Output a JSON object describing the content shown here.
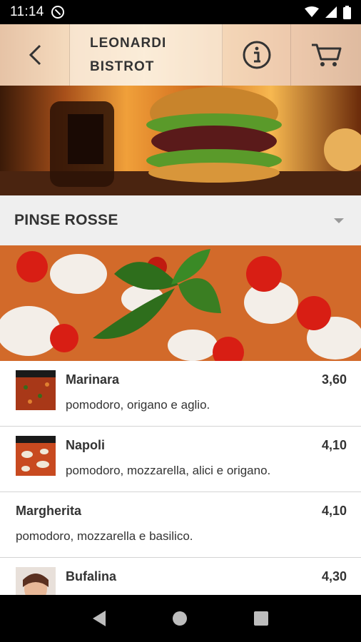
{
  "status_bar": {
    "time": "11:14",
    "icons": [
      "do-not-disturb-icon",
      "wifi-icon",
      "signal-icon",
      "battery-icon"
    ]
  },
  "header": {
    "title_line1": "LEONARDI",
    "title_line2": "BISTROT",
    "icons": [
      "back-arrow-icon",
      "info-icon",
      "cart-icon"
    ]
  },
  "category": {
    "name": "PINSE ROSSE",
    "expand_icon": "dropdown-arrow-icon"
  },
  "items": [
    {
      "name": "Marinara",
      "price": "3,60",
      "description": "pomodoro, origano e aglio."
    },
    {
      "name": "Napoli",
      "price": "4,10",
      "description": "pomodoro, mozzarella, alici e origano."
    },
    {
      "name": "Margherita",
      "price": "4,10",
      "description": "pomodoro, mozzarella e basilico."
    },
    {
      "name": "Bufalina",
      "price": "4,30",
      "description": ""
    }
  ],
  "nav_bar": {
    "icons": [
      "nav-back-icon",
      "nav-home-icon",
      "nav-recents-icon"
    ]
  },
  "colors": {
    "status_bar": "#000000",
    "category_bg": "#efefef",
    "text": "#333333",
    "divider": "#d4d4d4"
  }
}
